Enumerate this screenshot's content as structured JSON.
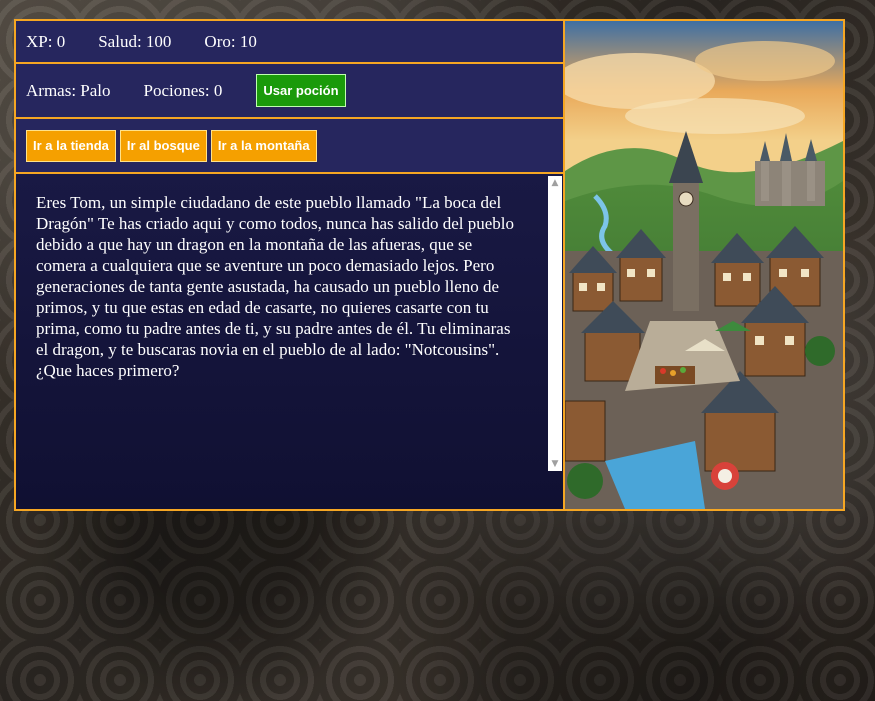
{
  "stats": {
    "xp_label": "XP:",
    "xp_value": "0",
    "health_label": "Salud:",
    "health_value": "100",
    "gold_label": "Oro:",
    "gold_value": "10"
  },
  "inventory": {
    "weapon_label": "Armas:",
    "weapon_value": "Palo",
    "potions_label": "Pociones:",
    "potions_value": "0",
    "use_potion_button": "Usar poción"
  },
  "actions": {
    "store_button": "Ir a la tienda",
    "forest_button": "Ir al bosque",
    "mountain_button": "Ir a la montaña"
  },
  "story": {
    "text": "Eres Tom, un simple ciudadano de este pueblo llamado \"La boca del Dragón\" Te has criado aqui y como todos, nunca has salido del pueblo debido a que hay un dragon en la montaña de las afueras, que se comera a cualquiera que se aventure un poco demasiado lejos. Pero generaciones de tanta gente asustada, ha causado un pueblo lleno de primos, y tu que estas en edad de casarte, no quieres casarte con tu prima, como tu padre antes de ti, y su padre antes de él. Tu eliminaras el dragon, y te buscaras novia en el pueblo de al lado: \"Notcousins\". ¿Que haces primero?"
  },
  "colors": {
    "accent_border": "#f5a623",
    "panel_bg": "#1c1c46",
    "orange_button": "#f5a000",
    "green_button": "#1a9a0a"
  },
  "scene_image": {
    "subject": "medieval-village-with-clock-tower-and-castle"
  }
}
